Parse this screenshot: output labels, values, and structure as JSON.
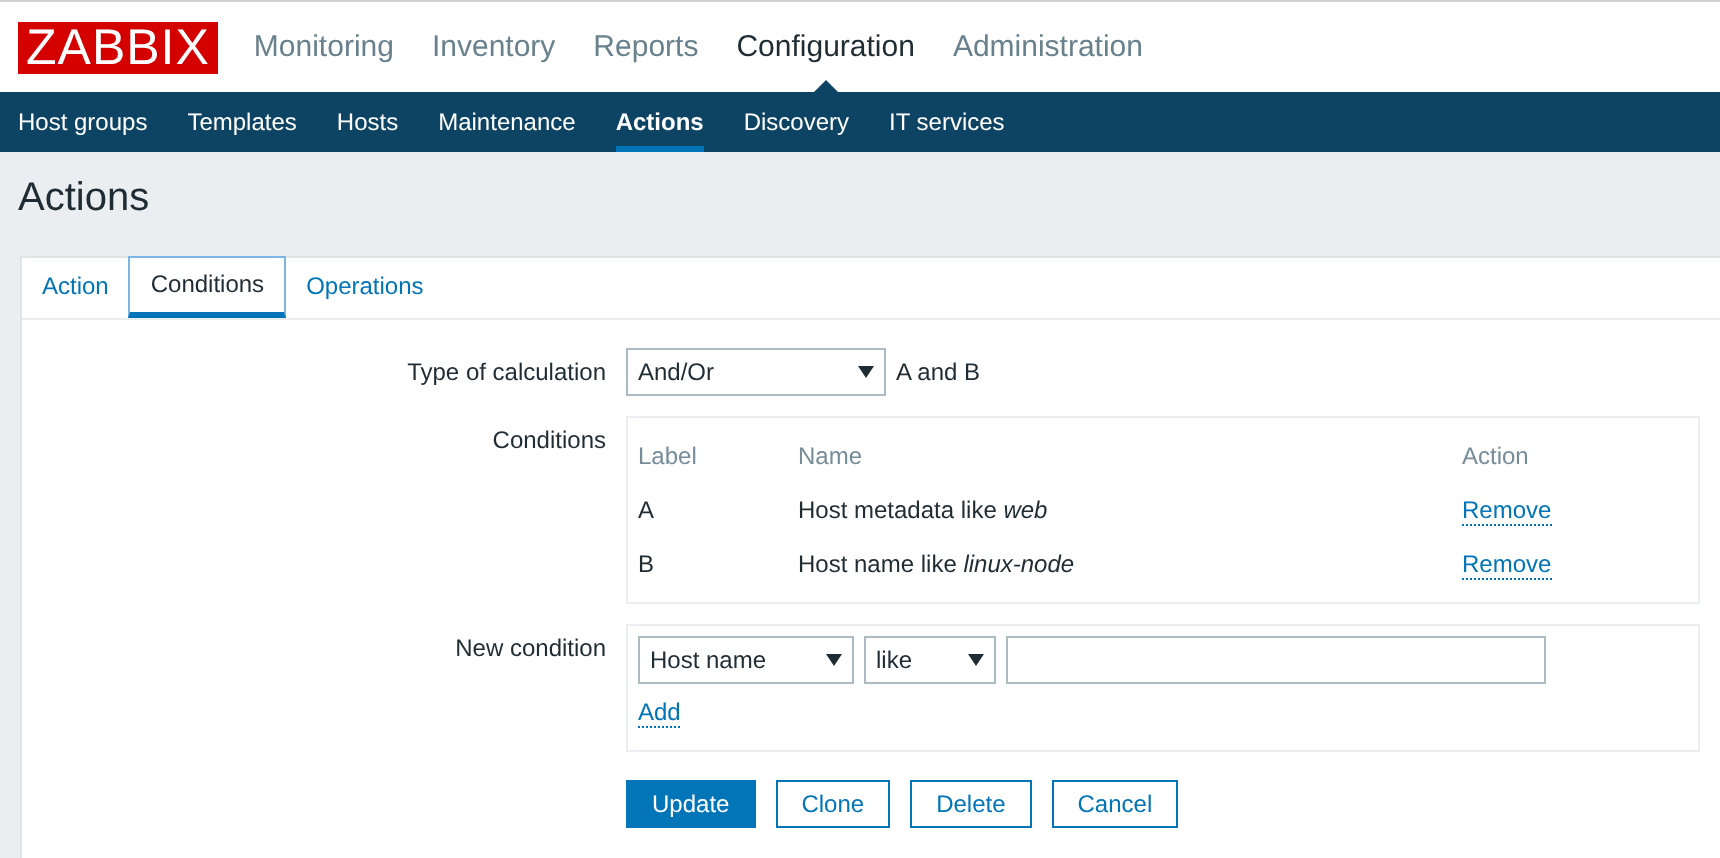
{
  "logo": "ZABBIX",
  "main_menu": [
    {
      "label": "Monitoring",
      "selected": false
    },
    {
      "label": "Inventory",
      "selected": false
    },
    {
      "label": "Reports",
      "selected": false
    },
    {
      "label": "Configuration",
      "selected": true
    },
    {
      "label": "Administration",
      "selected": false
    }
  ],
  "sub_menu": [
    {
      "label": "Host groups",
      "selected": false
    },
    {
      "label": "Templates",
      "selected": false
    },
    {
      "label": "Hosts",
      "selected": false
    },
    {
      "label": "Maintenance",
      "selected": false
    },
    {
      "label": "Actions",
      "selected": true
    },
    {
      "label": "Discovery",
      "selected": false
    },
    {
      "label": "IT services",
      "selected": false
    }
  ],
  "page_title": "Actions",
  "tabs": [
    {
      "label": "Action",
      "selected": false
    },
    {
      "label": "Conditions",
      "selected": true
    },
    {
      "label": "Operations",
      "selected": false
    }
  ],
  "type_of_calculation": {
    "label": "Type of calculation",
    "value": "And/Or",
    "formula": "A and B"
  },
  "conditions": {
    "label": "Conditions",
    "columns": [
      "Label",
      "Name",
      "Action"
    ],
    "rows": [
      {
        "label": "A",
        "name": "Host metadata like *web*",
        "action": "Remove"
      },
      {
        "label": "B",
        "name": "Host name like *linux-node*",
        "action": "Remove"
      }
    ]
  },
  "new_condition": {
    "label": "New condition",
    "type": "Host name",
    "operator": "like",
    "add": "Add"
  },
  "buttons": [
    {
      "label": "Update",
      "kind": "primary"
    },
    {
      "label": "Clone",
      "kind": "secondary"
    },
    {
      "label": "Delete",
      "kind": "secondary"
    },
    {
      "label": "Cancel",
      "kind": "secondary"
    }
  ]
}
